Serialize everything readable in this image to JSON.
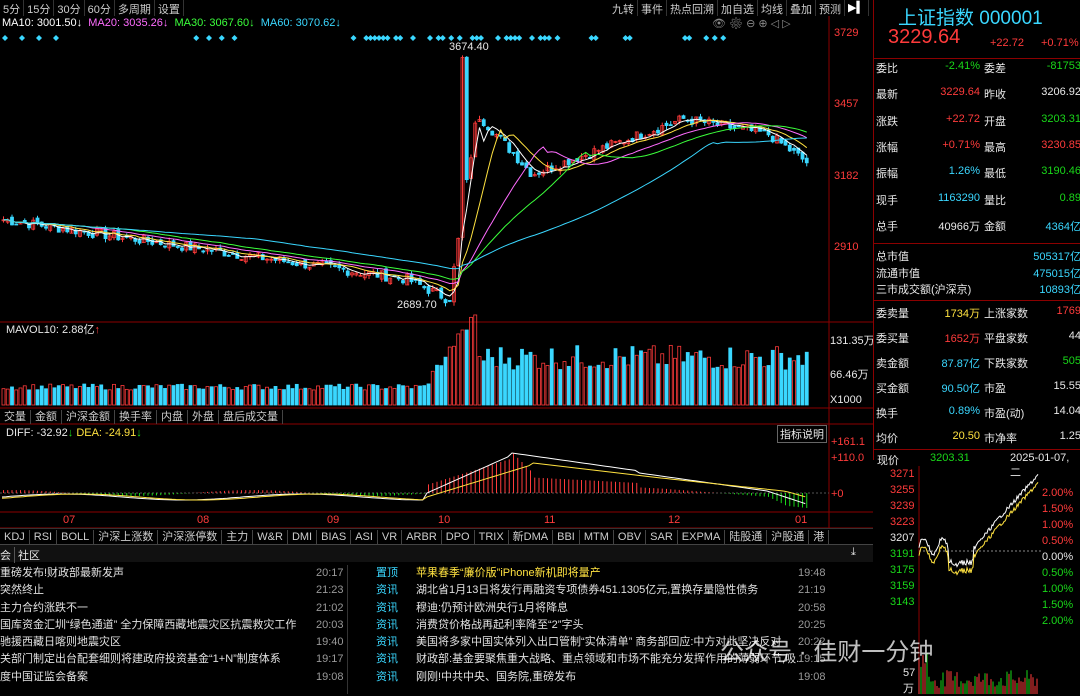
{
  "toolbar": {
    "periods": [
      "5分",
      "15分",
      "30分",
      "60分",
      "多周期",
      "设置"
    ],
    "right_tools": [
      "九转",
      "事件",
      "热点回溯",
      "加自选",
      "均线",
      "叠加",
      "预测"
    ]
  },
  "ma_legend": [
    {
      "label": "MA10: 3001.50↓",
      "color": "#ffffff"
    },
    {
      "label": "MA20: 3035.26↓",
      "color": "#ff6cff"
    },
    {
      "label": "MA30: 3067.60↓",
      "color": "#3bff3b"
    },
    {
      "label": "MA60: 3070.62↓",
      "color": "#3ad7ff"
    }
  ],
  "price_axis": [
    "3729",
    "3457",
    "3182",
    "2910"
  ],
  "price_annotations": {
    "high": "3674.40",
    "low": "2689.70"
  },
  "volume": {
    "legend": "MAVOL10: 2.88亿",
    "axis": [
      "131.35万",
      "66.46万",
      "X1000"
    ]
  },
  "subtabs": [
    "交量",
    "金额",
    "沪深金额",
    "换手率",
    "内盘",
    "外盘",
    "盘后成交量"
  ],
  "macd": {
    "legend_diff": "DIFF: -32.92",
    "legend_dea": "DEA: -24.91",
    "help": "指标说明",
    "axis": [
      "+161.1",
      "+110.0",
      "+0"
    ]
  },
  "months": [
    "07",
    "08",
    "09",
    "10",
    "11",
    "12",
    "01"
  ],
  "indicator_tabs": [
    "KDJ",
    "RSI",
    "BOLL",
    "沪深上涨数",
    "沪深涨停数",
    "主力",
    "W&R",
    "DMI",
    "BIAS",
    "ASI",
    "VR",
    "ARBR",
    "DPO",
    "TRIX",
    "新DMA",
    "BBI",
    "MTM",
    "OBV",
    "SAR",
    "EXPMA",
    "陆股通",
    "沪股通",
    "港"
  ],
  "quote": {
    "name": "上证指数",
    "code": "000001",
    "price": "3229.64",
    "change": "+22.72",
    "pct": "+0.71%"
  },
  "stats": [
    {
      "l1": "委比",
      "v1": "-2.41%",
      "c1": "green",
      "l2": "委差",
      "v2": "-81753",
      "c2": "green"
    },
    {
      "l1": "最新",
      "v1": "3229.64",
      "c1": "red",
      "l2": "昨收",
      "v2": "3206.92",
      "c2": "white"
    },
    {
      "l1": "涨跌",
      "v1": "+22.72",
      "c1": "red",
      "l2": "开盘",
      "v2": "3203.31",
      "c2": "green"
    },
    {
      "l1": "涨幅",
      "v1": "+0.71%",
      "c1": "red",
      "l2": "最高",
      "v2": "3230.85",
      "c2": "red"
    },
    {
      "l1": "振幅",
      "v1": "1.26%",
      "c1": "cyan",
      "l2": "最低",
      "v2": "3190.46",
      "c2": "green"
    },
    {
      "l1": "现手",
      "v1": "1163290",
      "c1": "cyan",
      "l2": "量比",
      "v2": "0.89",
      "c2": "green"
    },
    {
      "l1": "总手",
      "v1": "40966万",
      "c1": "white",
      "l2": "金额",
      "v2": "4364亿",
      "c2": "cyan"
    }
  ],
  "market": [
    {
      "l": "总市值",
      "v": "505317亿"
    },
    {
      "l": "流通市值",
      "v": "475015亿"
    },
    {
      "l": "三市成交额(沪深京)",
      "v": "10893亿"
    }
  ],
  "breadth": [
    {
      "l1": "委卖量",
      "v1": "1734万",
      "c1": "yellow",
      "l2": "上涨家数",
      "v2": "1769",
      "c2": "red"
    },
    {
      "l1": "委买量",
      "v1": "1652万",
      "c1": "red",
      "l2": "平盘家数",
      "v2": "44",
      "c2": "white"
    },
    {
      "l1": "卖金额",
      "v1": "87.87亿",
      "c1": "cyan",
      "l2": "下跌家数",
      "v2": "505",
      "c2": "green"
    },
    {
      "l1": "买金额",
      "v1": "90.50亿",
      "c1": "cyan",
      "l2": "市盈",
      "v2": "15.55",
      "c2": "white"
    },
    {
      "l1": "换手",
      "v1": "0.89%",
      "c1": "cyan",
      "l2": "市盈(动)",
      "v2": "14.04",
      "c2": "white"
    },
    {
      "l1": "均价",
      "v1": "20.50",
      "c1": "yellow",
      "l2": "市净率",
      "v2": "1.25",
      "c2": "white"
    }
  ],
  "intraday": {
    "label": "现价",
    "price": "3203.31",
    "date": "2025-01-07,二",
    "left_axis": [
      "3271",
      "3255",
      "3239",
      "3223",
      "3207",
      "3191",
      "3175",
      "3159",
      "3143"
    ],
    "right_axis": [
      "2.00%",
      "1.50%",
      "1.00%",
      "0.50%",
      "0.00%",
      "0.50%",
      "1.00%",
      "1.50%",
      "2.00%"
    ],
    "vol_unit": [
      "57",
      "万"
    ]
  },
  "news_tabs": [
    "会",
    "社区"
  ],
  "news_left": [
    {
      "title": "重磅发布!财政部最新发声",
      "time": "20:17"
    },
    {
      "title": "突然终止",
      "time": "21:23"
    },
    {
      "title": "主力合约涨跌不一",
      "time": "21:02"
    },
    {
      "title": "国库资金汇圳“绿色通道” 全力保障西藏地震灾区抗震救灾工作",
      "time": "20:03"
    },
    {
      "title": "驰援西藏日喀则地震灾区",
      "time": "19:40"
    },
    {
      "title": "关部门制定出台配套细则将建政府投资基金“1+N”制度体系",
      "time": "19:17"
    },
    {
      "title": "度中国证监会备案",
      "time": "19:08"
    }
  ],
  "news_right": [
    {
      "cat": "置顶",
      "title": "苹果春季“廉价版”iPhone新机即将量产",
      "time": "19:48"
    },
    {
      "cat": "资讯",
      "title": "湖北省1月13日将发行再融资专项债券451.1305亿元,置换存量隐性债务",
      "time": "21:19"
    },
    {
      "cat": "资讯",
      "title": "穆迪:仍预计欧洲央行1月将降息",
      "time": "20:58"
    },
    {
      "cat": "资讯",
      "title": "消费贷价格战再起利率降至“2”字头",
      "time": "20:25"
    },
    {
      "cat": "资讯",
      "title": "美国将多家中国实体列入出口管制“实体清单” 商务部回应:中方对此坚决反对",
      "time": "20:22"
    },
    {
      "cat": "资讯",
      "title": "财政部:基金要聚焦重大战略、重点领域和市场不能充分发挥作用的薄弱环节,吸..",
      "time": "19:15"
    },
    {
      "cat": "资讯",
      "title": "刚刚!中共中央、国务院,重磅发布",
      "time": "19:08"
    }
  ],
  "watermark": "公众号 · 佳财一分钟"
}
